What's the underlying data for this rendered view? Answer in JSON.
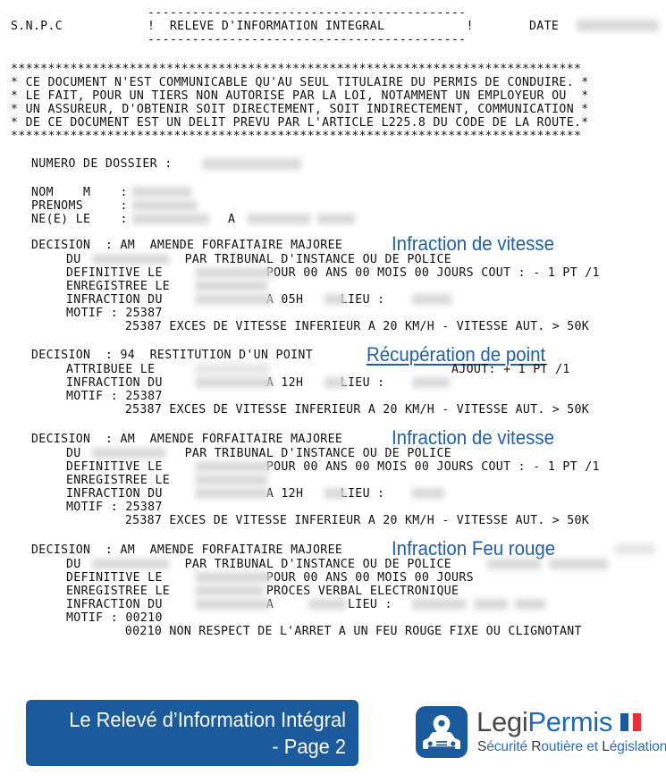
{
  "document": {
    "agency": "S.N.P.C",
    "title_bar_top": "-------------------------------------------",
    "title_bar_bottom": "-------------------------------------------",
    "title_line": "!  RELEVE D'INFORMATION INTEGRAL           !",
    "date_label": "DATE",
    "date_value_redacted": true,
    "notice": {
      "rule_top": "*****************************************************************************",
      "lines": [
        "* CE DOCUMENT N'EST COMMUNICABLE QU'AU SEUL TITULAIRE DU PERMIS DE CONDUIRE. *",
        "* LE FAIT, POUR UN TIERS NON AUTORISE PAR LA LOI, NOTAMMENT UN EMPLOYEUR OU  *",
        "* UN ASSUREUR, D'OBTENIR SOIT DIRECTEMENT, SOIT INDIRECTEMENT, COMMUNICATION *",
        "* DE CE DOCUMENT EST UN DELIT PREVU PAR L'ARTICLE L225.8 DU CODE DE LA ROUTE.*"
      ],
      "rule_bottom": "*****************************************************************************"
    },
    "identity": {
      "dossier_label": "NUMERO DE DOSSIER :",
      "nom_label": "NOM    M    :",
      "prenoms_label": "PRENOMS     :",
      "naissance_label": "NE(E) LE    :",
      "naissance_at": "A"
    },
    "decisions": [
      {
        "header": "DECISION  : AM  AMENDE FORFAITAIRE MAJOREE",
        "annotation": "Infraction de vitesse",
        "annotation_underlined": false,
        "lines": [
          "DU              PAR TRIBUNAL D'INSTANCE OU DE POLICE",
          "DEFINITIVE LE              POUR 00 ANS 00 MOIS 00 JOURS COUT : - 1 PT /1",
          "ENREGISTREE LE",
          "INFRACTION DU              A 05H     LIEU :",
          "MOTIF : 25387",
          "        25387 EXCES DE VITESSE INFERIEUR A 20 KM/H - VITESSE AUT. > 50K"
        ]
      },
      {
        "header": "DECISION  : 94  RESTITUTION D'UN POINT",
        "annotation": "Récupération de point",
        "annotation_underlined": true,
        "lines": [
          "ATTRIBUEE LE                                        AJOUT: + 1 PT /1",
          "INFRACTION DU              A 12H     LIEU :",
          "MOTIF : 25387",
          "        25387 EXCES DE VITESSE INFERIEUR A 20 KM/H - VITESSE AUT. > 50K"
        ]
      },
      {
        "header": "DECISION  : AM  AMENDE FORFAITAIRE MAJOREE",
        "annotation": "Infraction de vitesse",
        "annotation_underlined": false,
        "lines": [
          "DU              PAR TRIBUNAL D'INSTANCE OU DE POLICE",
          "DEFINITIVE LE              POUR 00 ANS 00 MOIS 00 JOURS COUT : - 1 PT /1",
          "ENREGISTREE LE",
          "INFRACTION DU              A 12H     LIEU :",
          "MOTIF : 25387",
          "        25387 EXCES DE VITESSE INFERIEUR A 20 KM/H - VITESSE AUT. > 50K"
        ]
      },
      {
        "header": "DECISION  : AM  AMENDE FORFAITAIRE MAJOREE",
        "annotation": "Infraction Feu rouge",
        "annotation_underlined": false,
        "lines": [
          "DU              PAR TRIBUNAL D'INSTANCE OU DE POLICE",
          "DEFINITIVE LE              POUR 00 ANS 00 MOIS 00 JOURS",
          "ENREGISTREE LE             PROCES VERBAL ELECTRONIQUE",
          "INFRACTION DU              A          LIEU :",
          "MOTIF : 00210",
          "        00210 NON RESPECT DE L'ARRET A UN FEU ROUGE FIXE OU CLIGNOTANT"
        ]
      }
    ]
  },
  "footer": {
    "banner_line1": "Le Relevé d’Information Intégral",
    "banner_line2": "- Page 2",
    "banner_color": "#1b5b9d",
    "logo": {
      "name_part1": "Legi",
      "name_part2": "Permis",
      "tagline_full": "Sécurité Routière et Législation",
      "tagline_s": "S",
      "tagline_ecurite": "écurité ",
      "tagline_r": "R",
      "tagline_outiere": "outière et ",
      "tagline_l": "L",
      "tagline_egislation": "égislation",
      "brand_blue": "#1e6ab5",
      "brand_gray": "#474747",
      "flag_blue": "#1b5b9d",
      "flag_red": "#e8303a"
    }
  }
}
